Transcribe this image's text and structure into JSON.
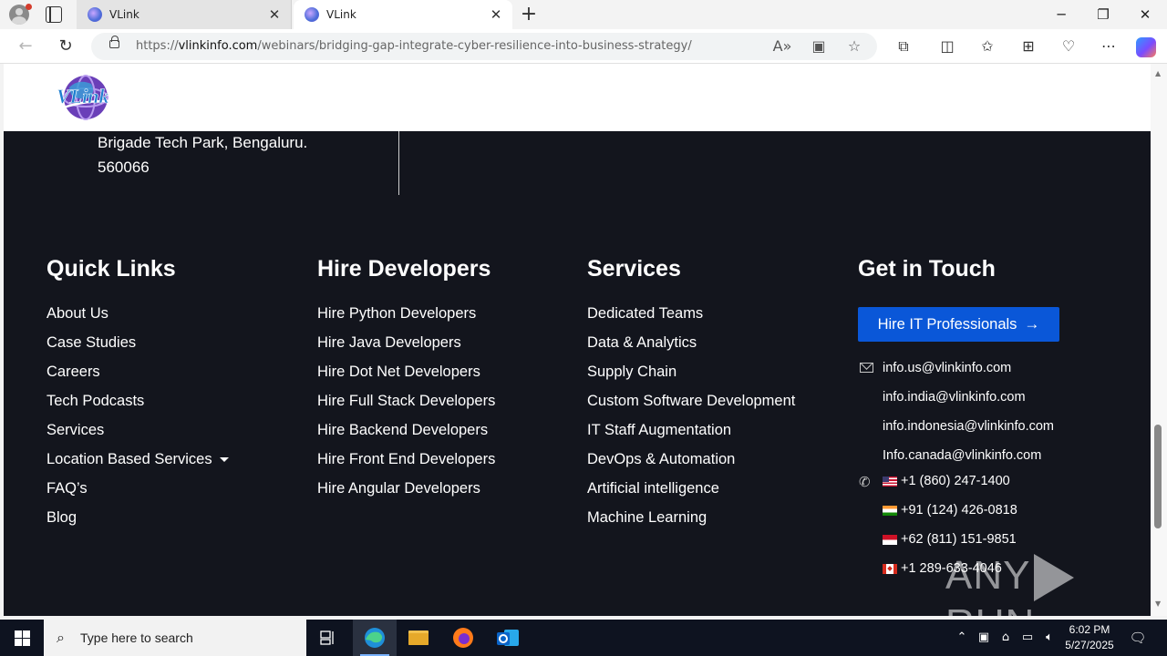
{
  "browser": {
    "tabs": [
      {
        "title": "VLink",
        "active": false
      },
      {
        "title": "VLink",
        "active": true
      }
    ],
    "url_prefix": "https://",
    "url_domain": "vlinkinfo.com",
    "url_path": "/webinars/bridging-gap-integrate-cyber-resilience-into-business-strategy/",
    "icons": [
      "back-icon",
      "refresh-icon",
      "lock-icon",
      "read-aloud-icon",
      "immersive-reader-icon",
      "favorite-icon",
      "extensions-icon",
      "split-screen-icon",
      "favorites-icon",
      "collections-icon",
      "browser-essentials-icon",
      "more-icon",
      "copilot-icon"
    ]
  },
  "page": {
    "address_lines": [
      "Brigade Tech Park, Bengaluru.",
      "560066"
    ],
    "quick_links": {
      "heading": "Quick Links",
      "items": [
        "About Us",
        "Case Studies",
        "Careers",
        "Tech Podcasts",
        "Services",
        "Location Based Services",
        "FAQ’s",
        "Blog"
      ]
    },
    "hire_developers": {
      "heading": "Hire Developers",
      "items": [
        "Hire Python Developers",
        "Hire Java Developers",
        "Hire Dot Net Developers",
        "Hire Full Stack Developers",
        "Hire Backend Developers",
        "Hire Front End Developers",
        "Hire Angular Developers"
      ]
    },
    "services": {
      "heading": "Services",
      "items": [
        "Dedicated Teams",
        "Data & Analytics",
        "Supply Chain",
        "Custom Software Development",
        "IT Staff Augmentation",
        "DevOps & Automation",
        "Artificial intelligence",
        "Machine Learning"
      ]
    },
    "get_in_touch": {
      "heading": "Get in Touch",
      "button_label": "Hire IT Professionals",
      "emails": [
        "info.us@vlinkinfo.com",
        "info.india@vlinkinfo.com",
        "info.indonesia@vlinkinfo.com",
        "Info.canada@vlinkinfo.com"
      ],
      "phones": [
        "+1 (860) 247-1400",
        "+91 (124) 426-0818",
        "+62 (811) 151-9851",
        "+1 289-633-4046"
      ]
    },
    "watermark": {
      "left": "ANY",
      "right": "RUN"
    }
  },
  "taskbar": {
    "search_placeholder": "Type here to search",
    "time": "6:02 PM",
    "date": "5/27/2025"
  },
  "colors": {
    "footer_bg": "#13151d",
    "button_blue": "#0a57d8",
    "taskbar_bg": "#0e1320"
  }
}
